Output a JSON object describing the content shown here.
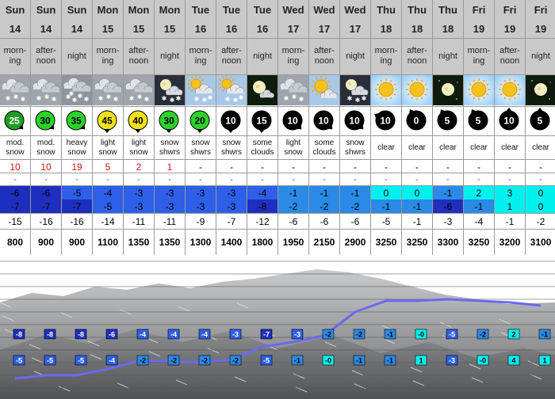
{
  "colors": {
    "header_bg": "#c9c9c9",
    "snow_red": "#d31515",
    "very_cold": "#1e2fbf",
    "cold": "#2d5fe8",
    "mild_cold": "#2a8ae6",
    "near_zero": "#00f0f0",
    "profile_line": "#6a6aee",
    "sun": "#f6c21a",
    "night_bg": "#0e1c0e"
  },
  "columns": [
    {
      "day": "Sun",
      "date": "14",
      "tod": [
        "morn-",
        "ing"
      ],
      "icon": "overcast-snow-icon",
      "wind": "25",
      "wind_bg": "#1f9d22",
      "wind_fg": "#ffffff",
      "wind_dir": 135,
      "cond": [
        "mod.",
        "snow"
      ],
      "snow": "10",
      "rain": "-",
      "t1": "-6",
      "t2": "-7",
      "chill": "-15",
      "frz": "800"
    },
    {
      "day": "Sun",
      "date": "14",
      "tod": [
        "after-",
        "noon"
      ],
      "icon": "overcast-snow-icon",
      "wind": "30",
      "wind_bg": "#2bd22b",
      "wind_fg": "#000000",
      "wind_dir": 135,
      "cond": [
        "mod.",
        "snow"
      ],
      "snow": "10",
      "rain": "-",
      "t1": "-6",
      "t2": "-7",
      "chill": "-16",
      "frz": "900"
    },
    {
      "day": "Sun",
      "date": "14",
      "tod": [
        "night"
      ],
      "icon": "overcast-heavy-snow-icon",
      "wind": "35",
      "wind_bg": "#2bd22b",
      "wind_fg": "#000000",
      "wind_dir": 135,
      "cond": [
        "heavy",
        "snow"
      ],
      "snow": "19",
      "rain": "-",
      "t1": "-5",
      "t2": "-7",
      "chill": "-16",
      "frz": "900"
    },
    {
      "day": "Mon",
      "date": "15",
      "tod": [
        "morn-",
        "ing"
      ],
      "icon": "overcast-snow-icon",
      "wind": "45",
      "wind_bg": "#f0e11b",
      "wind_fg": "#000000",
      "wind_dir": 180,
      "cond": [
        "light",
        "snow"
      ],
      "snow": "5",
      "rain": "-",
      "t1": "-4",
      "t2": "-5",
      "chill": "-14",
      "frz": "1100"
    },
    {
      "day": "Mon",
      "date": "15",
      "tod": [
        "after-",
        "noon"
      ],
      "icon": "overcast-snow-icon",
      "wind": "40",
      "wind_bg": "#f0e11b",
      "wind_fg": "#000000",
      "wind_dir": 180,
      "cond": [
        "light",
        "snow"
      ],
      "snow": "2",
      "rain": "-",
      "t1": "-3",
      "t2": "-3",
      "chill": "-11",
      "frz": "1350"
    },
    {
      "day": "Mon",
      "date": "15",
      "tod": [
        "night"
      ],
      "icon": "moon-cloud-snow-icon",
      "wind": "30",
      "wind_bg": "#2bd22b",
      "wind_fg": "#000000",
      "wind_dir": 180,
      "cond": [
        "snow",
        "shwrs"
      ],
      "snow": "1",
      "rain": "-",
      "t1": "-3",
      "t2": "-3",
      "chill": "-11",
      "frz": "1350"
    },
    {
      "day": "Tue",
      "date": "16",
      "tod": [
        "morn-",
        "ing"
      ],
      "icon": "sun-cloud-snow-icon",
      "wind": "20",
      "wind_bg": "#2bd22b",
      "wind_fg": "#000000",
      "wind_dir": 180,
      "cond": [
        "snow",
        "shwrs"
      ],
      "snow": "-",
      "rain": "-",
      "t1": "-3",
      "t2": "-3",
      "chill": "-9",
      "frz": "1300"
    },
    {
      "day": "Tue",
      "date": "16",
      "tod": [
        "after-",
        "noon"
      ],
      "icon": "sun-cloud-snow-icon",
      "wind": "10",
      "wind_bg": "#000000",
      "wind_fg": "#ffffff",
      "wind_dir": 180,
      "cond": [
        "snow",
        "shwrs"
      ],
      "snow": "-",
      "rain": "-",
      "t1": "-3",
      "t2": "-3",
      "chill": "-7",
      "frz": "1400"
    },
    {
      "day": "Tue",
      "date": "16",
      "tod": [
        "night"
      ],
      "icon": "moon-cloud-icon",
      "wind": "15",
      "wind_bg": "#000000",
      "wind_fg": "#ffffff",
      "wind_dir": 180,
      "cond": [
        "some",
        "clouds"
      ],
      "snow": "-",
      "rain": "-",
      "t1": "-4",
      "t2": "-8",
      "chill": "-12",
      "frz": "1800"
    },
    {
      "day": "Wed",
      "date": "17",
      "tod": [
        "morn-",
        "ing"
      ],
      "icon": "overcast-snow-icon",
      "wind": "10",
      "wind_bg": "#000000",
      "wind_fg": "#ffffff",
      "wind_dir": 135,
      "cond": [
        "light",
        "snow"
      ],
      "snow": "-",
      "rain": "-",
      "t1": "-1",
      "t2": "-2",
      "chill": "-6",
      "frz": "1950"
    },
    {
      "day": "Wed",
      "date": "17",
      "tod": [
        "after-",
        "noon"
      ],
      "icon": "sun-cloud-icon",
      "wind": "10",
      "wind_bg": "#000000",
      "wind_fg": "#ffffff",
      "wind_dir": 135,
      "cond": [
        "some",
        "clouds"
      ],
      "snow": "-",
      "rain": "-",
      "t1": "-1",
      "t2": "-2",
      "chill": "-6",
      "frz": "2150"
    },
    {
      "day": "Wed",
      "date": "17",
      "tod": [
        "night"
      ],
      "icon": "moon-cloud-snow-icon",
      "wind": "10",
      "wind_bg": "#000000",
      "wind_fg": "#ffffff",
      "wind_dir": 135,
      "cond": [
        "snow",
        "shwrs"
      ],
      "snow": "-",
      "rain": "-",
      "t1": "-1",
      "t2": "-2",
      "chill": "-6",
      "frz": "2900"
    },
    {
      "day": "Thu",
      "date": "18",
      "tod": [
        "morn-",
        "ing"
      ],
      "icon": "sun-icon",
      "wind": "10",
      "wind_bg": "#000000",
      "wind_fg": "#ffffff",
      "wind_dir": 300,
      "cond": [
        "clear"
      ],
      "snow": "-",
      "rain": "-",
      "t1": "0",
      "t2": "-1",
      "chill": "-5",
      "frz": "3250"
    },
    {
      "day": "Thu",
      "date": "18",
      "tod": [
        "after-",
        "noon"
      ],
      "icon": "sun-icon",
      "wind": "0",
      "wind_bg": "#000000",
      "wind_fg": "#ffffff",
      "wind_dir": 330,
      "cond": [
        "clear"
      ],
      "snow": "-",
      "rain": "-",
      "t1": "0",
      "t2": "-1",
      "chill": "-1",
      "frz": "3250"
    },
    {
      "day": "Thu",
      "date": "18",
      "tod": [
        "night"
      ],
      "icon": "moon-icon",
      "wind": "5",
      "wind_bg": "#000000",
      "wind_fg": "#ffffff",
      "wind_dir": 330,
      "cond": [
        "clear"
      ],
      "snow": "-",
      "rain": "-",
      "t1": "-1",
      "t2": "-6",
      "chill": "-3",
      "frz": "3300"
    },
    {
      "day": "Fri",
      "date": "19",
      "tod": [
        "morn-",
        "ing"
      ],
      "icon": "sun-icon",
      "wind": "5",
      "wind_bg": "#000000",
      "wind_fg": "#ffffff",
      "wind_dir": 330,
      "cond": [
        "clear"
      ],
      "snow": "-",
      "rain": "-",
      "t1": "2",
      "t2": "-1",
      "chill": "-4",
      "frz": "3250"
    },
    {
      "day": "Fri",
      "date": "19",
      "tod": [
        "after-",
        "noon"
      ],
      "icon": "sun-icon",
      "wind": "10",
      "wind_bg": "#000000",
      "wind_fg": "#ffffff",
      "wind_dir": 0,
      "cond": [
        "clear"
      ],
      "snow": "-",
      "rain": "-",
      "t1": "3",
      "t2": "1",
      "chill": "-1",
      "frz": "3200"
    },
    {
      "day": "Fri",
      "date": "19",
      "tod": [
        "night"
      ],
      "icon": "moon-icon",
      "wind": "5",
      "wind_bg": "#000000",
      "wind_fg": "#ffffff",
      "wind_dir": 0,
      "cond": [
        "clear"
      ],
      "snow": "-",
      "rain": "-",
      "t1": "0",
      "t2": "0",
      "chill": "-2",
      "frz": "3100"
    }
  ],
  "profile": {
    "upper_tags": [
      "-8",
      "-8",
      "-8",
      "-6",
      "-4",
      "-4",
      "-4",
      "-3",
      "-7",
      "-3",
      "-2",
      "-2",
      "-1",
      "-0",
      "-5",
      "-2",
      "2",
      "-1"
    ],
    "lower_tags": [
      "-5",
      "-5",
      "-5",
      "-4",
      "-2",
      "-2",
      "-2",
      "-2",
      "-5",
      "-1",
      "-0",
      "-1",
      "-1",
      "1",
      "-3",
      "-0",
      "4",
      "1"
    ],
    "freezing_level_m": [
      800,
      900,
      900,
      1100,
      1350,
      1350,
      1300,
      1400,
      1800,
      1950,
      2150,
      2900,
      3250,
      3250,
      3300,
      3250,
      3200,
      3100
    ]
  }
}
